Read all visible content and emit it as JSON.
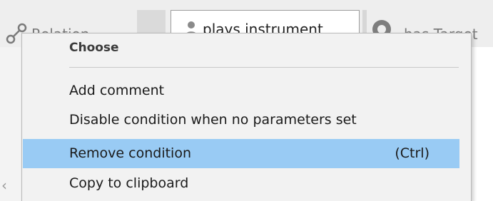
{
  "toolbar": {
    "relation_label": "Relation",
    "field_value": "plays instrument",
    "target_label": "has Target"
  },
  "context_menu": {
    "header": "Choose",
    "items": [
      {
        "label": "Add comment",
        "shortcut": ""
      },
      {
        "label": "Disable condition when no parameters set",
        "shortcut": ""
      },
      {
        "label": "Remove condition",
        "shortcut": "(Ctrl)",
        "highlighted": true
      },
      {
        "label": "Copy to clipboard",
        "shortcut": ""
      }
    ]
  },
  "scroll": {
    "left_arrow": "‹"
  },
  "colors": {
    "menu_background": "#f2f2f2",
    "highlight": "#99cbf4",
    "header_text": "#3a3a3a"
  },
  "icons": [
    "relation-icon",
    "plus-icon",
    "person-icon",
    "target-icon",
    "scroll-left-arrow-icon"
  ]
}
